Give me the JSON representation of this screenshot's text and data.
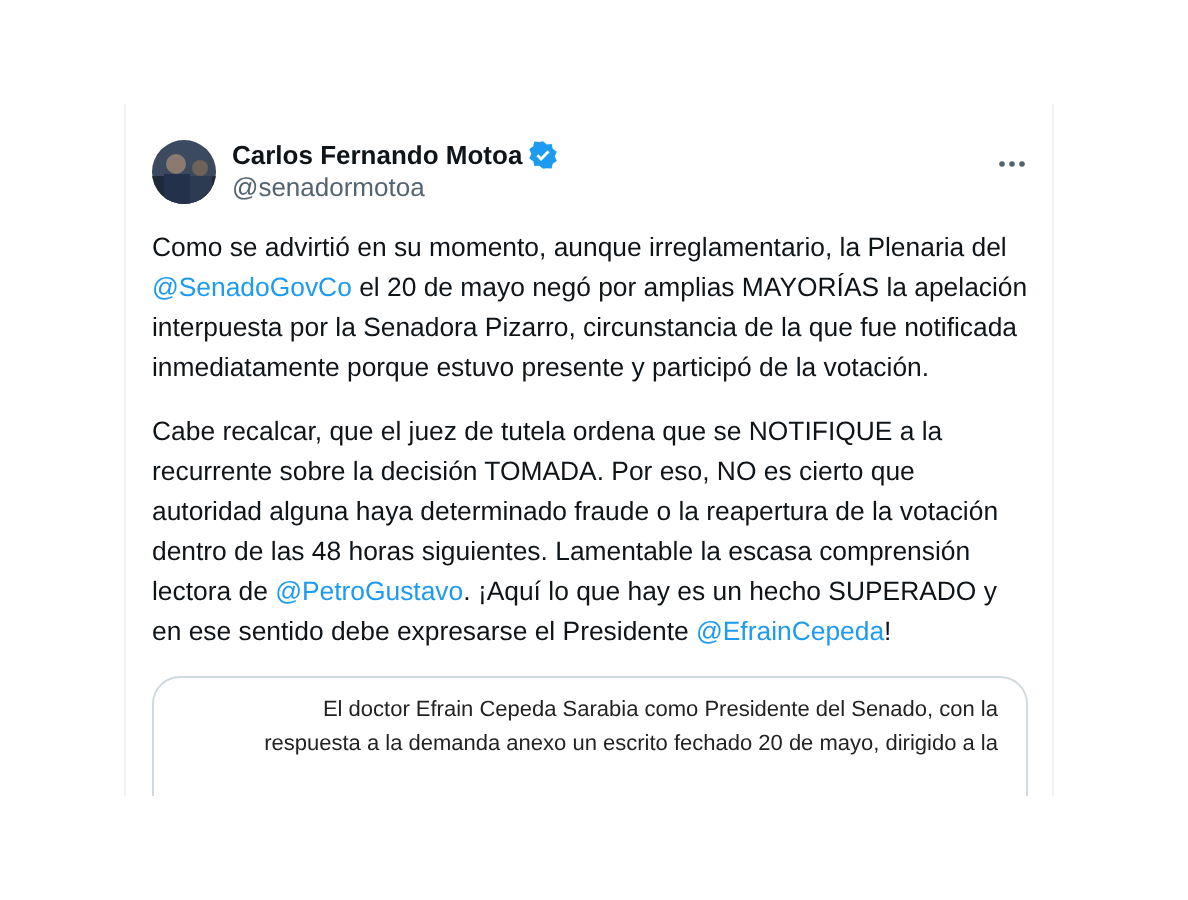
{
  "post": {
    "author": {
      "name": "Carlos Fernando Motoa",
      "handle": "@senadormotoa",
      "verified": true
    },
    "paragraphs": [
      [
        {
          "kind": "text",
          "text": "Como se advirtió en su momento, aunque irreglamentario, la Plenaria del "
        },
        {
          "kind": "mention",
          "text": "@SenadoGovCo"
        },
        {
          "kind": "text",
          "text": " el 20 de mayo negó por amplias MAYORÍAS la apelación interpuesta por la Senadora Pizarro, circunstancia de la que fue notificada inmediatamente porque estuvo presente y participó de la votación."
        }
      ],
      [
        {
          "kind": "text",
          "text": "Cabe recalcar, que el juez de tutela ordena que se NOTIFIQUE a la recurrente sobre la decisión TOMADA. Por eso, NO es cierto que autoridad alguna haya determinado fraude o la reapertura de la votación dentro de las 48 horas siguientes. Lamentable la escasa comprensión lectora de "
        },
        {
          "kind": "mention",
          "text": "@PetroGustavo"
        },
        {
          "kind": "text",
          "text": ". ¡Aquí lo que hay es un hecho SUPERADO y en ese sentido debe expresarse el Presidente "
        },
        {
          "kind": "mention",
          "text": "@EfrainCepeda"
        },
        {
          "kind": "text",
          "text": "!"
        }
      ]
    ],
    "document_lines": [
      "El doctor Efrain Cepeda Sarabia como Presidente del Senado, con la",
      "respuesta a la demanda anexo un escrito fechado 20 de mayo, dirigido a la"
    ]
  }
}
